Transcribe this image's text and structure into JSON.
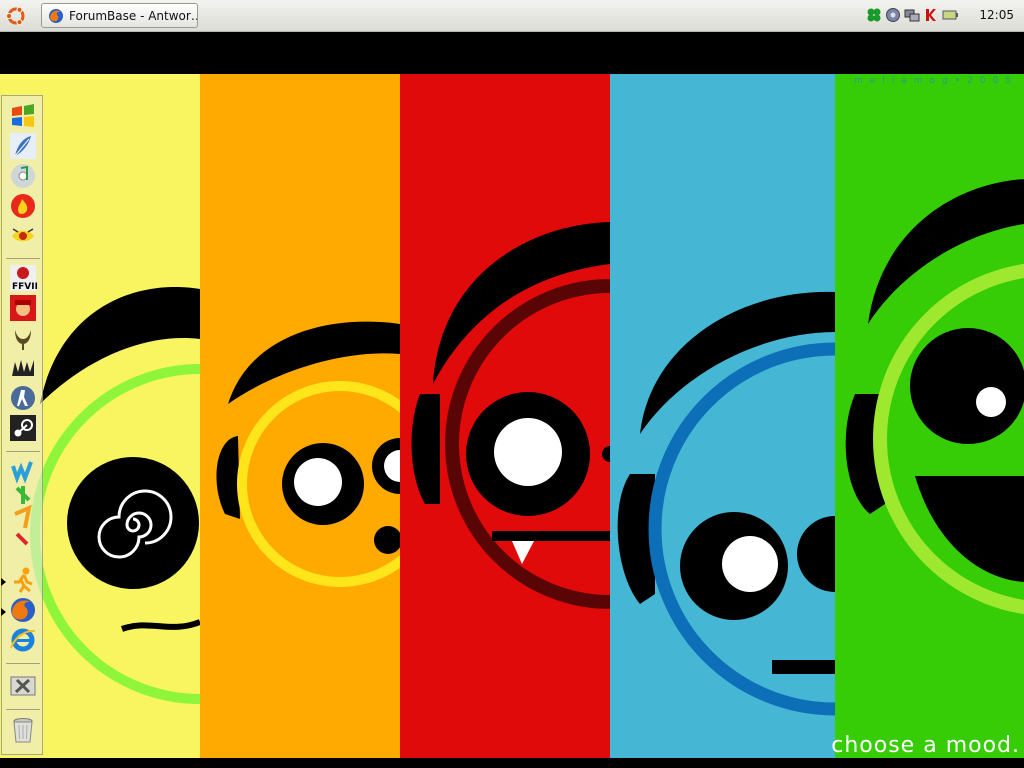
{
  "panel": {
    "task_title": "ForumBase - Antwor…",
    "clock": "12:05",
    "tray_icons": [
      "clover-icon",
      "gear-icon",
      "network-icon",
      "antivirus-k-icon",
      "battery-icon"
    ]
  },
  "wallpaper": {
    "credit": "mellamog•2005",
    "caption": "choose a mood.",
    "stripe_colors": [
      "#f8f560",
      "#ffaa00",
      "#e00a0a",
      "#45b6d4",
      "#36cc06"
    ]
  },
  "dock": {
    "items": [
      "windows-icon",
      "feather-icon",
      "music-cd-icon",
      "firefox-fire-icon",
      "eye-icon",
      "ffviii-icon",
      "mario-icon",
      "quake-icon",
      "darkage-icon",
      "counter-strike-icon",
      "steam-icon",
      "winamp-icon",
      "runner-icon",
      "firefox-icon",
      "internet-explorer-icon",
      "tools-icon",
      "trash-icon"
    ]
  }
}
